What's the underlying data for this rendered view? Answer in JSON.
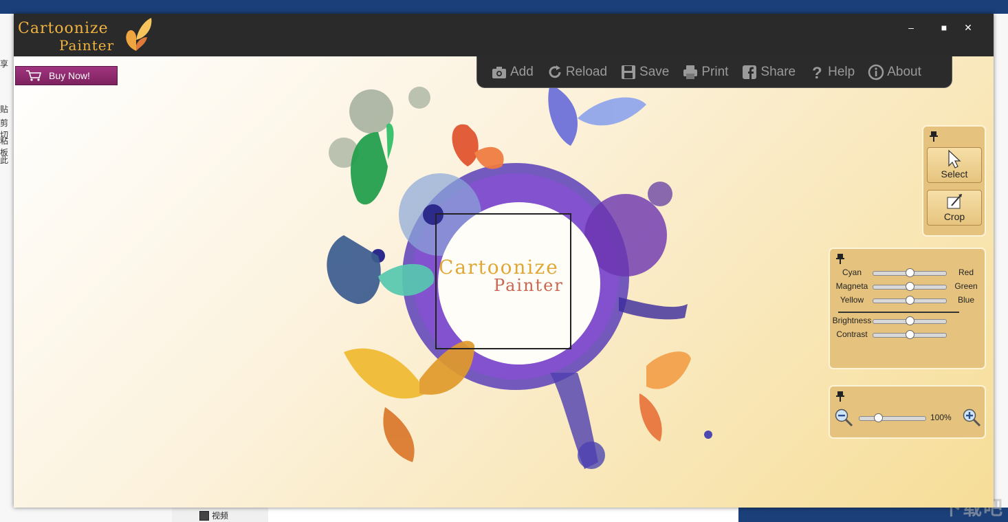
{
  "desktop": {
    "left_chars": [
      "享",
      "贴",
      "剪切",
      "粘板",
      "此"
    ],
    "explorer_item": "视频",
    "watermark": "下载吧"
  },
  "window": {
    "logo_line1": "Cartoonize",
    "logo_line2": "Painter",
    "controls": {
      "minimize": "–",
      "maximize": "■",
      "close": "✕"
    }
  },
  "buy_now": "Buy Now!",
  "toolbar": [
    {
      "icon": "camera-add-icon",
      "label": "Add"
    },
    {
      "icon": "reload-icon",
      "label": "Reload"
    },
    {
      "icon": "save-icon",
      "label": "Save"
    },
    {
      "icon": "print-icon",
      "label": "Print"
    },
    {
      "icon": "facebook-icon",
      "label": "Share"
    },
    {
      "icon": "help-icon",
      "label": "Help"
    },
    {
      "icon": "info-icon",
      "label": "About"
    }
  ],
  "artwork": {
    "title_line1": "Cartoonize",
    "title_line2": "Painter"
  },
  "tools_panel": {
    "select": "Select",
    "crop": "Crop"
  },
  "color_panel": {
    "sliders": [
      {
        "left": "Cyan",
        "right": "Red",
        "value": 0.5
      },
      {
        "left": "Magneta",
        "right": "Green",
        "value": 0.5
      },
      {
        "left": "Yellow",
        "right": "Blue",
        "value": 0.5
      },
      {
        "left": "Brightness",
        "right": "",
        "value": 0.5
      },
      {
        "left": "Contrast",
        "right": "",
        "value": 0.5
      }
    ]
  },
  "zoom_panel": {
    "value_label": "100%",
    "value": 0.25
  },
  "colors": {
    "accent_buy": "#8e2a6f",
    "toolbar_bg": "#2b2b2b",
    "panel_bg": "#e5c37e"
  }
}
